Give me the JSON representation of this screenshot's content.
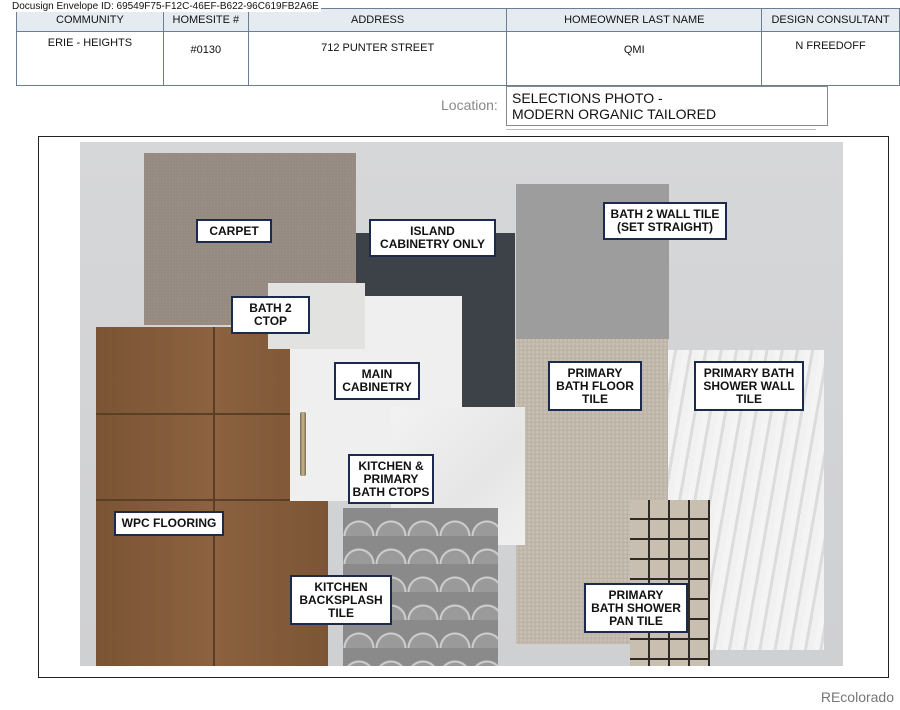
{
  "envelope": "Docusign Envelope ID: 69549F75-F12C-46EF-B622-96C619FB2A6E",
  "header": {
    "columns": [
      "COMMUNITY",
      "HOMESITE #",
      "ADDRESS",
      "HOMEOWNER LAST NAME",
      "DESIGN CONSULTANT"
    ],
    "values": [
      "ERIE - HEIGHTS",
      "#0130",
      "712 PUNTER STREET",
      "QMI",
      "N  FREEDOFF"
    ]
  },
  "location": {
    "label": "Location:",
    "line1": "SELECTIONS PHOTO -",
    "line2": "MODERN ORGANIC TAILORED"
  },
  "labels": {
    "carpet": "CARPET",
    "island": [
      "ISLAND",
      "CABINETRY ONLY"
    ],
    "bath2_wall": [
      "BATH 2 WALL TILE",
      "(SET STRAIGHT)"
    ],
    "bath2_ctop": [
      "BATH 2",
      "CTOP"
    ],
    "main_cab": [
      "MAIN",
      "CABINETRY"
    ],
    "primary_floor": [
      "PRIMARY",
      "BATH FLOOR",
      "TILE"
    ],
    "primary_shower_wall": [
      "PRIMARY BATH",
      "SHOWER WALL",
      "TILE"
    ],
    "kitchen_ctops": [
      "KITCHEN &",
      "PRIMARY",
      "BATH CTOPS"
    ],
    "wpc": "WPC FLOORING",
    "backsplash": [
      "KITCHEN",
      "BACKSPLASH",
      "TILE"
    ],
    "pan": [
      "PRIMARY",
      "BATH SHOWER",
      "PAN TILE"
    ]
  },
  "footer": {
    "brand": "REcolorado"
  },
  "colors": {
    "label_border": "#1b2a4e",
    "header_fill": "#e6ebf2",
    "table_border": "#6b7e93"
  }
}
